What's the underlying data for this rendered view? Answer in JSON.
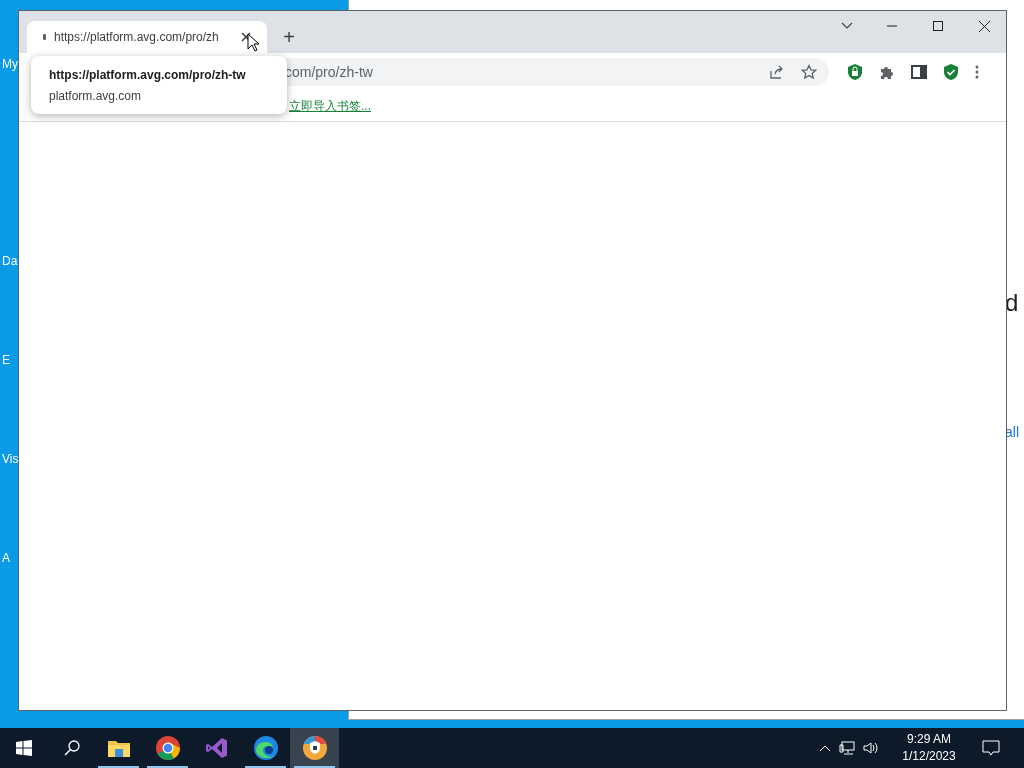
{
  "desktop_icons": [
    {
      "label": "My"
    },
    {
      "label": "Da"
    },
    {
      "label": "E"
    },
    {
      "label": "Vis"
    },
    {
      "label": "A"
    }
  ],
  "background_window": {
    "heading": "d",
    "link": "all"
  },
  "browser": {
    "tab": {
      "title": "https://platform.avg.com/pro/zh",
      "selected": true
    },
    "tooltip": {
      "url": "https://platform.avg.com/pro/zh-tw",
      "domain": "platform.avg.com"
    },
    "new_tab": "+",
    "address": "com/pro/zh-tw",
    "bookmark_link": "立即导入书签..."
  },
  "taskbar": {
    "apps": [
      {
        "kind": "explorer",
        "running": true,
        "selected": false
      },
      {
        "kind": "chrome",
        "running": true,
        "selected": false
      },
      {
        "kind": "studio",
        "running": false,
        "selected": false
      },
      {
        "kind": "edge",
        "running": true,
        "selected": false
      },
      {
        "kind": "secure-browser",
        "running": true,
        "selected": true
      }
    ],
    "time": "9:29 AM",
    "date": "1/12/2023"
  }
}
